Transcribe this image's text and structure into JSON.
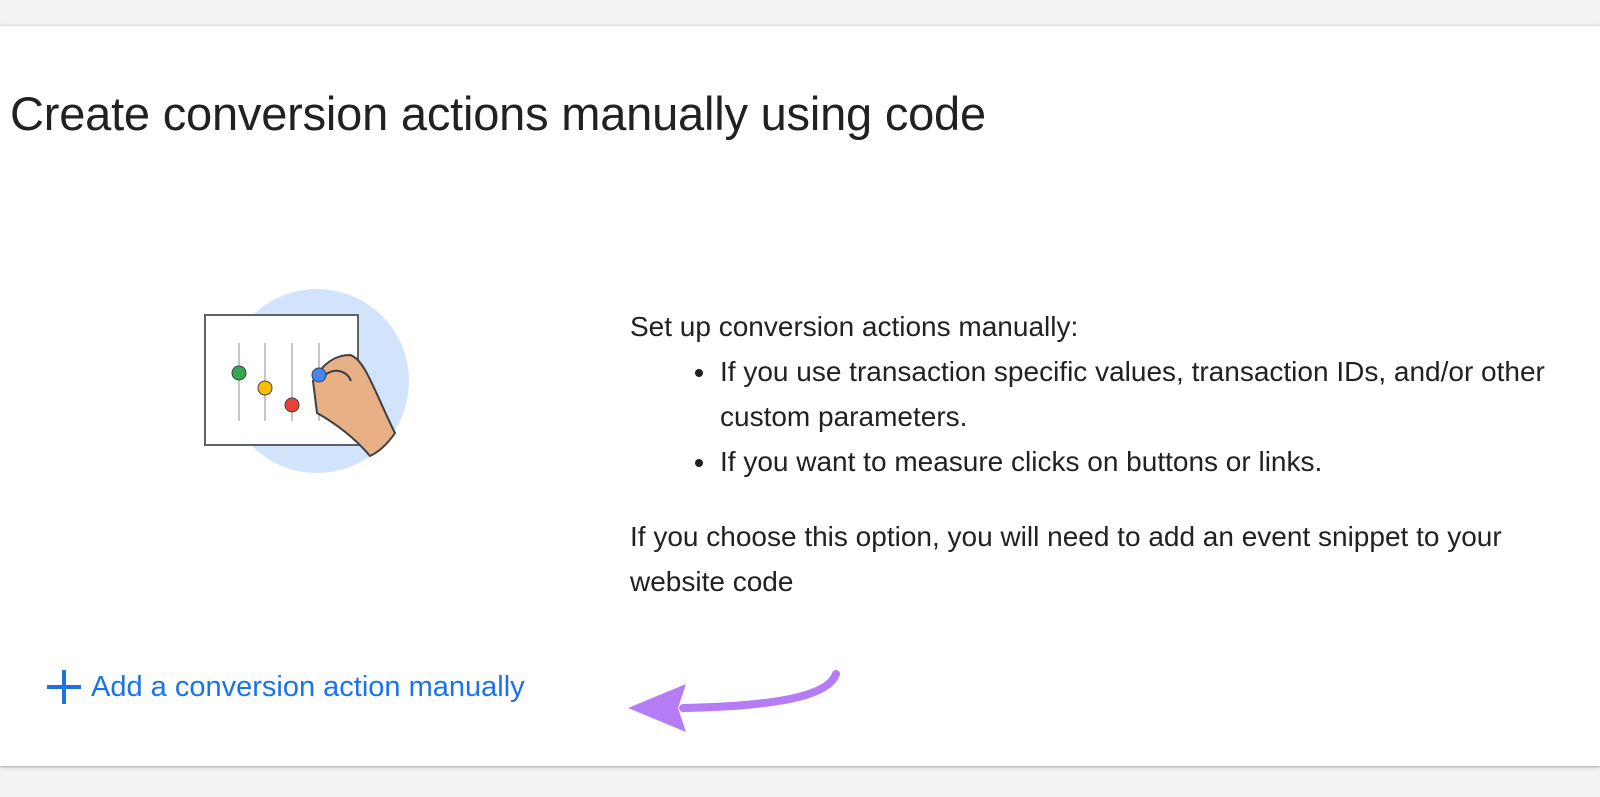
{
  "page": {
    "title": "Create conversion actions manually using code"
  },
  "description": {
    "intro": "Set up conversion actions manually:",
    "bullets": [
      "If you use transaction specific values, transaction IDs, and/or other custom parameters.",
      "If you want to measure clicks on buttons or links."
    ],
    "note": "If you choose this option, you will need to add an event snippet to your website code"
  },
  "action": {
    "add_label": "Add a conversion action manually",
    "icon": "plus-icon"
  },
  "annotation": {
    "icon": "arrow-icon",
    "color": "#b57cf6"
  },
  "colors": {
    "link": "#1a73e8",
    "text": "#202124",
    "background": "#f1f3f4",
    "card": "#ffffff"
  }
}
